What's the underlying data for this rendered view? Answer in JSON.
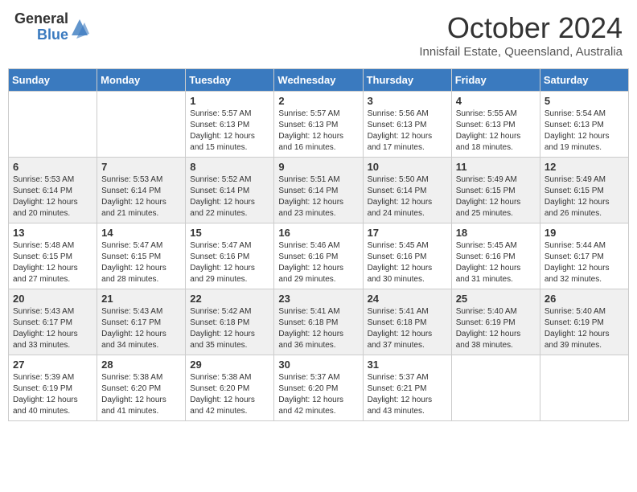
{
  "logo": {
    "general": "General",
    "blue": "Blue"
  },
  "title": "October 2024",
  "subtitle": "Innisfail Estate, Queensland, Australia",
  "days_of_week": [
    "Sunday",
    "Monday",
    "Tuesday",
    "Wednesday",
    "Thursday",
    "Friday",
    "Saturday"
  ],
  "weeks": [
    [
      {
        "day": "",
        "info": ""
      },
      {
        "day": "",
        "info": ""
      },
      {
        "day": "1",
        "info": "Sunrise: 5:57 AM\nSunset: 6:13 PM\nDaylight: 12 hours and 15 minutes."
      },
      {
        "day": "2",
        "info": "Sunrise: 5:57 AM\nSunset: 6:13 PM\nDaylight: 12 hours and 16 minutes."
      },
      {
        "day": "3",
        "info": "Sunrise: 5:56 AM\nSunset: 6:13 PM\nDaylight: 12 hours and 17 minutes."
      },
      {
        "day": "4",
        "info": "Sunrise: 5:55 AM\nSunset: 6:13 PM\nDaylight: 12 hours and 18 minutes."
      },
      {
        "day": "5",
        "info": "Sunrise: 5:54 AM\nSunset: 6:13 PM\nDaylight: 12 hours and 19 minutes."
      }
    ],
    [
      {
        "day": "6",
        "info": "Sunrise: 5:53 AM\nSunset: 6:14 PM\nDaylight: 12 hours and 20 minutes."
      },
      {
        "day": "7",
        "info": "Sunrise: 5:53 AM\nSunset: 6:14 PM\nDaylight: 12 hours and 21 minutes."
      },
      {
        "day": "8",
        "info": "Sunrise: 5:52 AM\nSunset: 6:14 PM\nDaylight: 12 hours and 22 minutes."
      },
      {
        "day": "9",
        "info": "Sunrise: 5:51 AM\nSunset: 6:14 PM\nDaylight: 12 hours and 23 minutes."
      },
      {
        "day": "10",
        "info": "Sunrise: 5:50 AM\nSunset: 6:14 PM\nDaylight: 12 hours and 24 minutes."
      },
      {
        "day": "11",
        "info": "Sunrise: 5:49 AM\nSunset: 6:15 PM\nDaylight: 12 hours and 25 minutes."
      },
      {
        "day": "12",
        "info": "Sunrise: 5:49 AM\nSunset: 6:15 PM\nDaylight: 12 hours and 26 minutes."
      }
    ],
    [
      {
        "day": "13",
        "info": "Sunrise: 5:48 AM\nSunset: 6:15 PM\nDaylight: 12 hours and 27 minutes."
      },
      {
        "day": "14",
        "info": "Sunrise: 5:47 AM\nSunset: 6:15 PM\nDaylight: 12 hours and 28 minutes."
      },
      {
        "day": "15",
        "info": "Sunrise: 5:47 AM\nSunset: 6:16 PM\nDaylight: 12 hours and 29 minutes."
      },
      {
        "day": "16",
        "info": "Sunrise: 5:46 AM\nSunset: 6:16 PM\nDaylight: 12 hours and 29 minutes."
      },
      {
        "day": "17",
        "info": "Sunrise: 5:45 AM\nSunset: 6:16 PM\nDaylight: 12 hours and 30 minutes."
      },
      {
        "day": "18",
        "info": "Sunrise: 5:45 AM\nSunset: 6:16 PM\nDaylight: 12 hours and 31 minutes."
      },
      {
        "day": "19",
        "info": "Sunrise: 5:44 AM\nSunset: 6:17 PM\nDaylight: 12 hours and 32 minutes."
      }
    ],
    [
      {
        "day": "20",
        "info": "Sunrise: 5:43 AM\nSunset: 6:17 PM\nDaylight: 12 hours and 33 minutes."
      },
      {
        "day": "21",
        "info": "Sunrise: 5:43 AM\nSunset: 6:17 PM\nDaylight: 12 hours and 34 minutes."
      },
      {
        "day": "22",
        "info": "Sunrise: 5:42 AM\nSunset: 6:18 PM\nDaylight: 12 hours and 35 minutes."
      },
      {
        "day": "23",
        "info": "Sunrise: 5:41 AM\nSunset: 6:18 PM\nDaylight: 12 hours and 36 minutes."
      },
      {
        "day": "24",
        "info": "Sunrise: 5:41 AM\nSunset: 6:18 PM\nDaylight: 12 hours and 37 minutes."
      },
      {
        "day": "25",
        "info": "Sunrise: 5:40 AM\nSunset: 6:19 PM\nDaylight: 12 hours and 38 minutes."
      },
      {
        "day": "26",
        "info": "Sunrise: 5:40 AM\nSunset: 6:19 PM\nDaylight: 12 hours and 39 minutes."
      }
    ],
    [
      {
        "day": "27",
        "info": "Sunrise: 5:39 AM\nSunset: 6:19 PM\nDaylight: 12 hours and 40 minutes."
      },
      {
        "day": "28",
        "info": "Sunrise: 5:38 AM\nSunset: 6:20 PM\nDaylight: 12 hours and 41 minutes."
      },
      {
        "day": "29",
        "info": "Sunrise: 5:38 AM\nSunset: 6:20 PM\nDaylight: 12 hours and 42 minutes."
      },
      {
        "day": "30",
        "info": "Sunrise: 5:37 AM\nSunset: 6:20 PM\nDaylight: 12 hours and 42 minutes."
      },
      {
        "day": "31",
        "info": "Sunrise: 5:37 AM\nSunset: 6:21 PM\nDaylight: 12 hours and 43 minutes."
      },
      {
        "day": "",
        "info": ""
      },
      {
        "day": "",
        "info": ""
      }
    ]
  ]
}
